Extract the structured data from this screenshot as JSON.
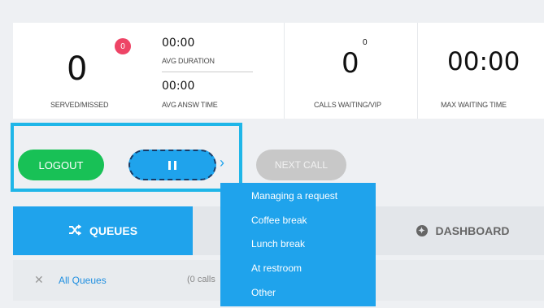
{
  "stats": {
    "served_value": "0",
    "served_badge": "0",
    "served_label": "SERVED/MISSED",
    "avg_duration_value": "00:00",
    "avg_duration_label": "AVG DURATION",
    "avg_answer_value": "00:00",
    "avg_answer_label": "AVG ANSW TIME",
    "calls_waiting_value": "0",
    "calls_waiting_vip": "0",
    "calls_waiting_label": "CALLS WAITING/VIP",
    "max_waiting_value": "00:00",
    "max_waiting_label": "MAX WAITING TIME"
  },
  "controls": {
    "logout_label": "LOGOUT",
    "next_call_label": "NEXT CALL"
  },
  "tabs": {
    "queues_label": "QUEUES",
    "dashboard_label": "DASHBOARD"
  },
  "queue_row": {
    "link_label": "All Queues",
    "calls_text": "(0 calls"
  },
  "pause_menu": {
    "items": [
      "Managing a request",
      "Coffee break",
      "Lunch break",
      "At restroom",
      "Other"
    ]
  },
  "colors": {
    "accent": "#1fa3ec",
    "logout": "#18c156",
    "badge": "#ee4466",
    "highlight_border": "#1fb6e8"
  }
}
